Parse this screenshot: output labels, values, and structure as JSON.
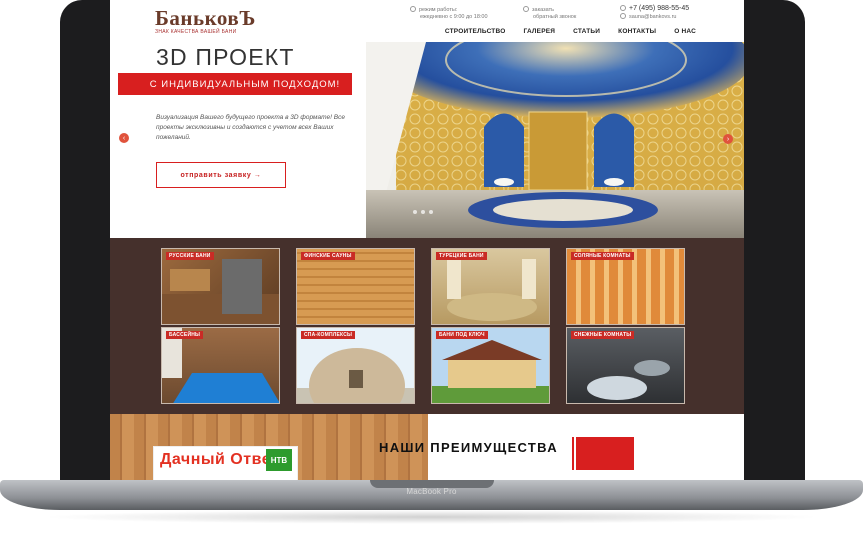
{
  "device": {
    "label": "MacBook Pro"
  },
  "header": {
    "logo_main": "БаньковЪ",
    "logo_sub": "ЗНАК КАЧЕСТВА ВАШЕЙ БАНИ",
    "hours_line1": "режим работы:",
    "hours_line2": "ежедневно с 9:00 до 18:00",
    "callback_line1": "заказать",
    "callback_line2": "обратный звонок",
    "phone": "+7 (495) 988-55-45",
    "email": "sauna@bankovs.ru"
  },
  "nav": {
    "items": [
      {
        "label": "СТРОИТЕЛЬСТВО"
      },
      {
        "label": "ГАЛЕРЕЯ"
      },
      {
        "label": "СТАТЬИ"
      },
      {
        "label": "КОНТАКТЫ"
      },
      {
        "label": "О НАС"
      }
    ]
  },
  "hero": {
    "title": "3D ПРОЕКТ",
    "subtitle": "С ИНДИВИДУАЛЬНЫМ ПОДХОДОМ!",
    "description": "Визуализация Вашего будущего проекта в 3D формате! Все проекты эксклюзивны и создаются с учетом всех Ваших пожеланий.",
    "button": "отправить заявку  →",
    "arrow_left": "‹",
    "arrow_right": "›"
  },
  "categories": [
    {
      "label": "РУССКИЕ БАНИ"
    },
    {
      "label": "ФИНСКИЕ САУНЫ"
    },
    {
      "label": "ТУРЕЦКИЕ БАНИ"
    },
    {
      "label": "СОЛЯНЫЕ КОМНАТЫ"
    },
    {
      "label": "БАССЕЙНЫ"
    },
    {
      "label": "СПА-КОМПЛЕКСЫ"
    },
    {
      "label": "БАНИ ПОД КЛЮЧ"
    },
    {
      "label": "СНЕЖНЫЕ КОМНАТЫ"
    }
  ],
  "bottom": {
    "tv_text": "Дачный Ответ",
    "tv_logo": "НТВ",
    "advantages_title": "НАШИ ПРЕИМУЩЕСТВА"
  },
  "colors": {
    "accent_red": "#d81f1f",
    "category_bg": "#45302c",
    "logo_brown": "#6a3b2a"
  }
}
